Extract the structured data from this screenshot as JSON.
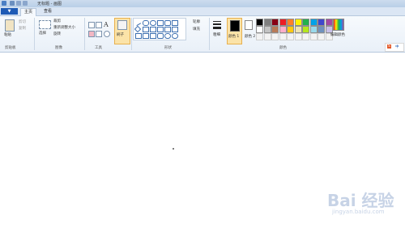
{
  "window": {
    "title": "无标题 - 画图"
  },
  "tabs": {
    "file": "▼",
    "home": "主页",
    "view": "查看"
  },
  "clipboard": {
    "paste": "粘贴",
    "cut": "剪切",
    "copy": "复制",
    "label": "剪贴板"
  },
  "image": {
    "select": "选择",
    "crop": "裁剪",
    "resize": "重新调整大小",
    "rotate": "旋转",
    "label": "图像"
  },
  "tools": {
    "label": "工具"
  },
  "brushes": {
    "label": "刷子"
  },
  "shapes": {
    "outline": "轮廓",
    "fill": "填充",
    "label": "形状"
  },
  "size": {
    "label": "粗细"
  },
  "colors": {
    "color1": "颜色 1",
    "color2": "颜色 2",
    "edit": "编辑颜色",
    "label": "颜色",
    "palette_row1": [
      "#000000",
      "#7f7f7f",
      "#880015",
      "#ed1c24",
      "#ff7f27",
      "#fff200",
      "#22b14c",
      "#00a2e8",
      "#3f48cc",
      "#a349a4"
    ],
    "palette_row2": [
      "#ffffff",
      "#c3c3c3",
      "#b97a57",
      "#ffaec9",
      "#ffc90e",
      "#efe4b0",
      "#b5e61d",
      "#99d9ea",
      "#7092be",
      "#c8bfe7"
    ]
  },
  "watermark": {
    "text": "Bai 经验",
    "url": "jingyan.baidu.com"
  },
  "ime": {
    "label": "中"
  }
}
